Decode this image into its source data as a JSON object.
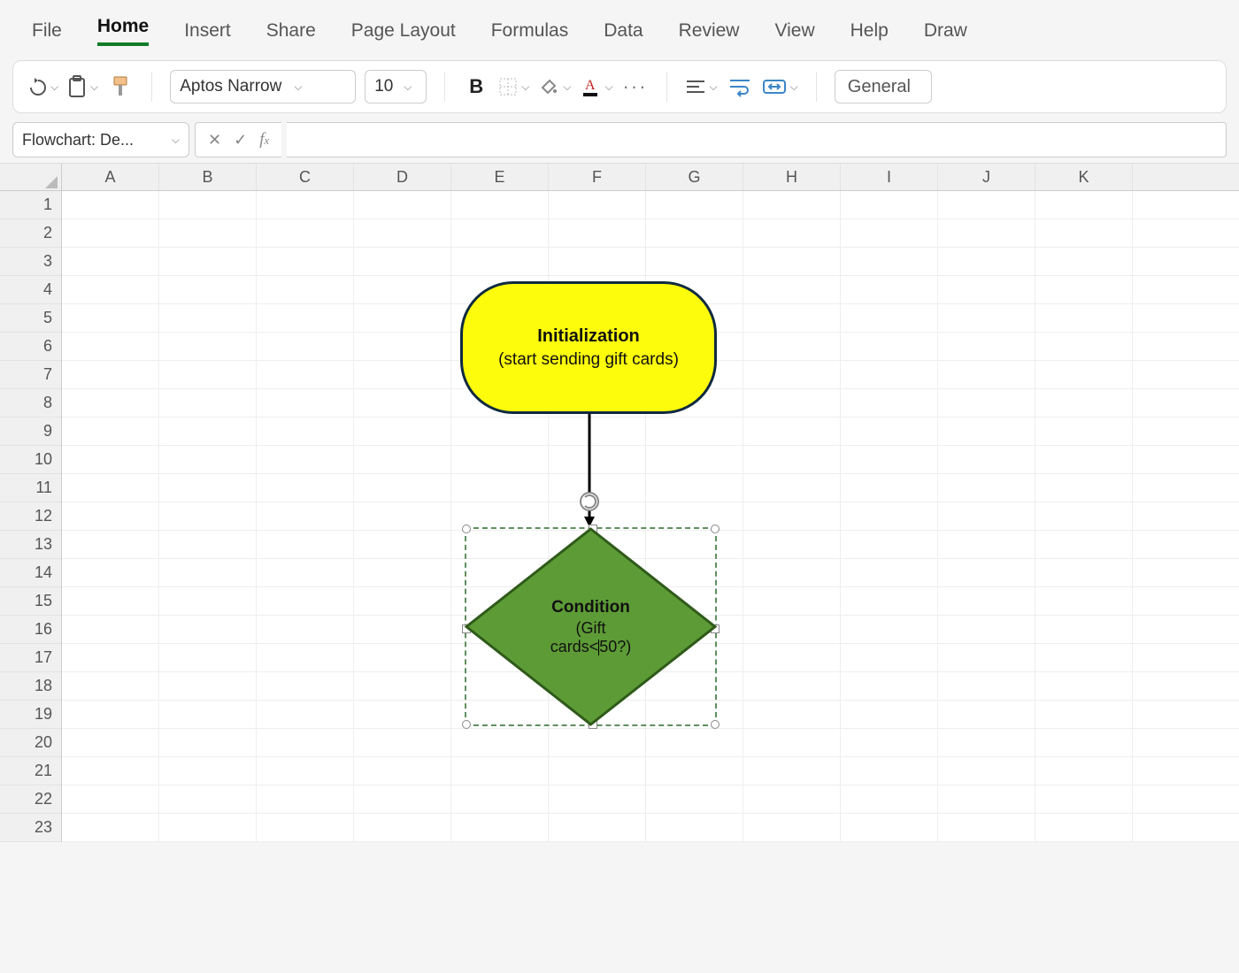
{
  "ribbon": {
    "tabs": [
      "File",
      "Home",
      "Insert",
      "Share",
      "Page Layout",
      "Formulas",
      "Data",
      "Review",
      "View",
      "Help",
      "Draw"
    ],
    "active": "Home"
  },
  "toolbar": {
    "font_name": "Aptos Narrow",
    "font_size": "10",
    "number_format": "General"
  },
  "namebox": {
    "value": "Flowchart: De..."
  },
  "grid": {
    "columns": [
      "A",
      "B",
      "C",
      "D",
      "E",
      "F",
      "G",
      "H",
      "I",
      "J",
      "K"
    ],
    "rows": [
      "1",
      "2",
      "3",
      "4",
      "5",
      "6",
      "7",
      "8",
      "9",
      "10",
      "11",
      "12",
      "13",
      "14",
      "15",
      "16",
      "17",
      "18",
      "19",
      "20",
      "21",
      "22",
      "23"
    ]
  },
  "shapes": {
    "terminator": {
      "title": "Initialization",
      "subtitle": "(start sending gift cards)"
    },
    "decision": {
      "title": "Condition",
      "line2_pre": "(Gift",
      "line3_pre": "cards<",
      "line3_post": "50?)"
    }
  }
}
